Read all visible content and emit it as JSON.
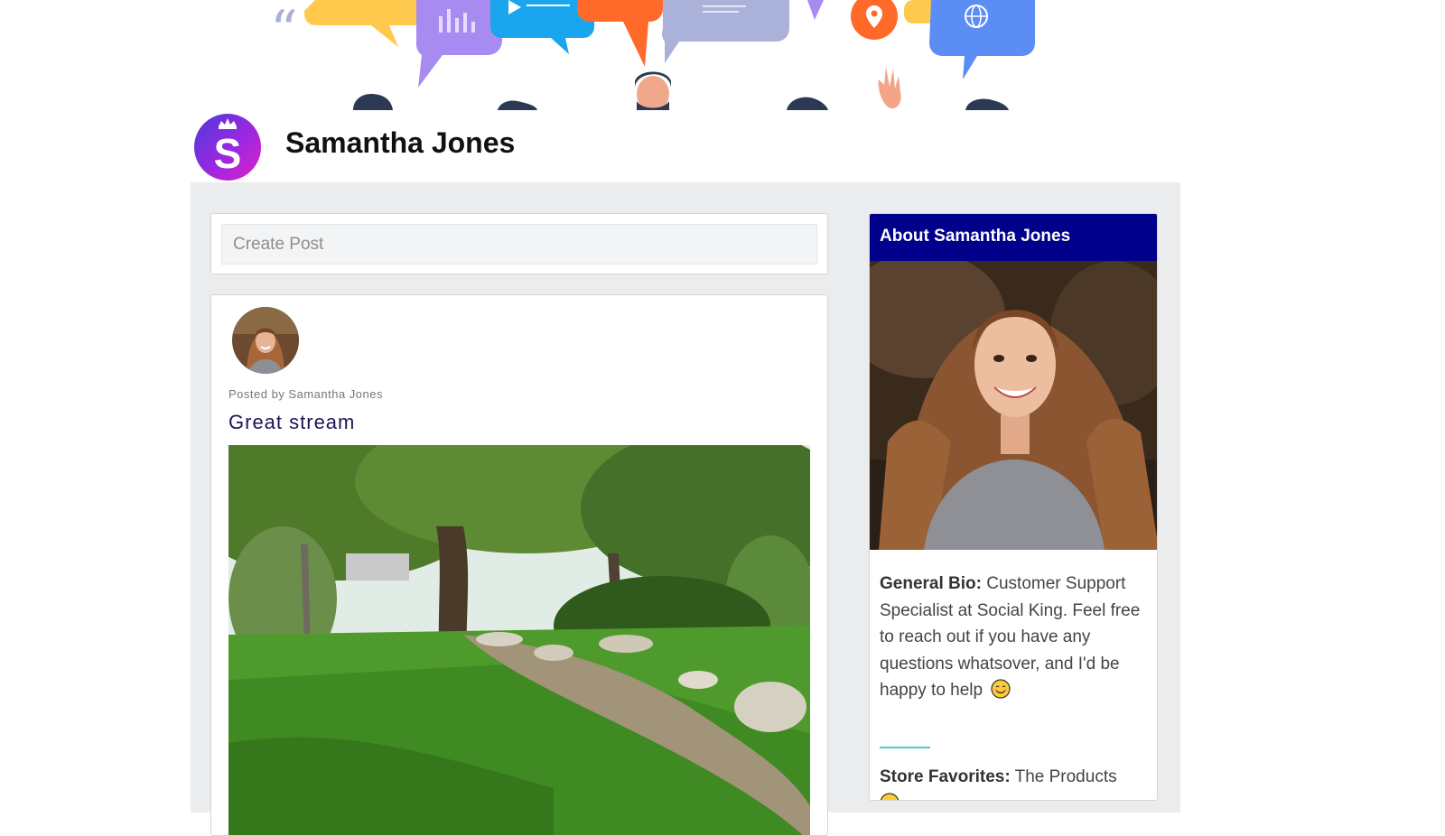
{
  "profile": {
    "name": "Samantha Jones"
  },
  "create_post": {
    "placeholder": "Create Post"
  },
  "post": {
    "meta": "Posted by Samantha Jones",
    "title": "Great stream"
  },
  "about": {
    "title": "About Samantha Jones",
    "bio_label": "General Bio:",
    "bio_text": "Customer Support Specialist at Social King. Feel free to reach out if you have any questions whatsover, and I'd be happy to help",
    "favorites_label": "Store Favorites:",
    "favorites_text": "The Products"
  },
  "icons": {
    "logo": "logo-s-crown-icon",
    "bio_emoji": "smiling-face-emoji-icon",
    "favorites_emoji": "relieved-face-emoji-icon"
  },
  "colors": {
    "about_header": "#00008b",
    "post_title": "#1c1457",
    "content_bg": "#ebecee",
    "divider": "#5bc7c7"
  }
}
